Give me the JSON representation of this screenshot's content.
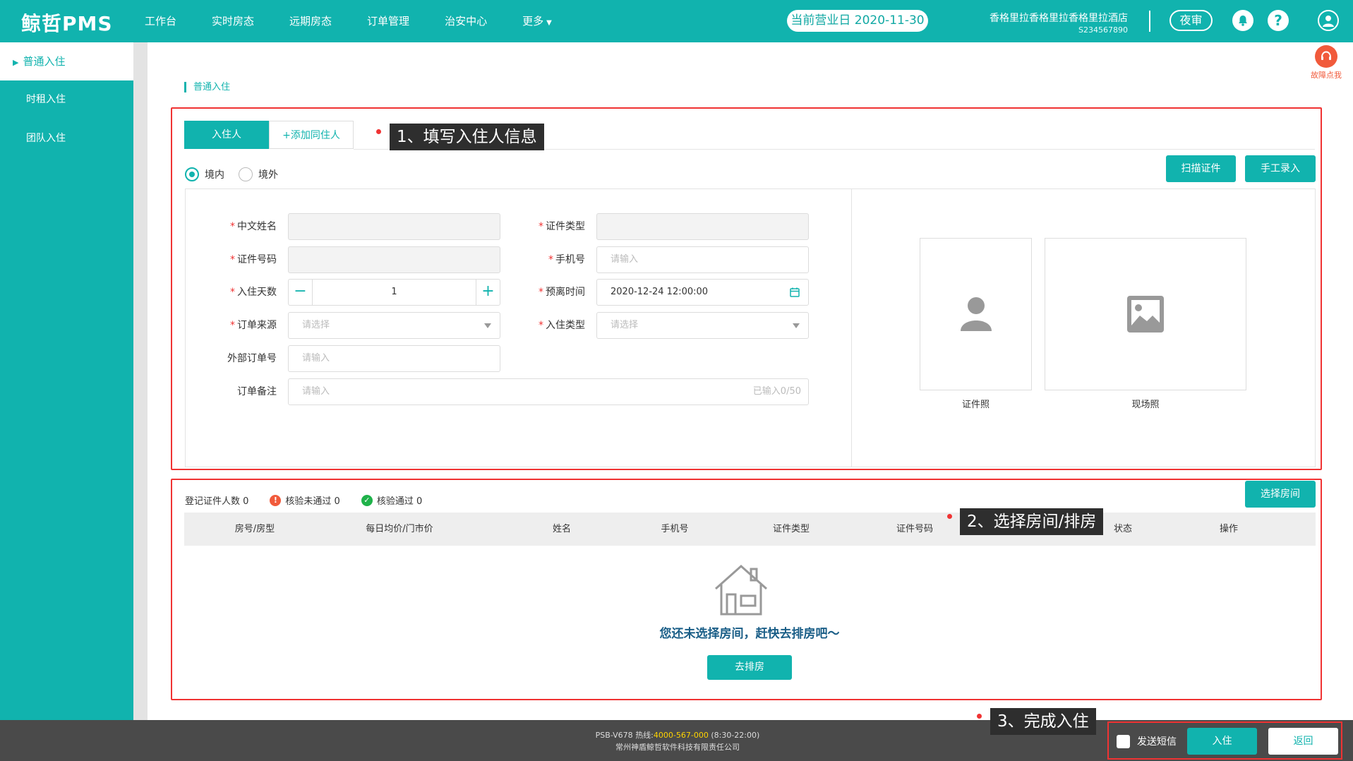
{
  "app": {
    "logo": "鲸哲PMS",
    "nav": [
      "工作台",
      "实时房态",
      "远期房态",
      "订单管理",
      "治安中心",
      "更多"
    ],
    "business_day": "当前营业日 2020-11-30",
    "hotel_name": "香格里拉香格里拉香格里拉酒店",
    "hotel_code": "S234567890",
    "night_audit": "夜审"
  },
  "sidebar": {
    "items": [
      "普通入住",
      "时租入住",
      "团队入住"
    ]
  },
  "fault": {
    "label": "故障点我"
  },
  "breadcrumb": "普通入住",
  "tabs": {
    "guest": "入住人",
    "add": "+添加同住人"
  },
  "callouts": [
    "1、填写入住人信息",
    "2、选择房间/排房",
    "3、完成入住"
  ],
  "origin": {
    "domestic": "境内",
    "foreign": "境外"
  },
  "buttons": {
    "scan": "扫描证件",
    "manual": "手工录入",
    "select_room": "选择房间",
    "assign": "去排房",
    "checkin": "入住",
    "back": "返回"
  },
  "form": {
    "name_label": "中文姓名",
    "id_type_label": "证件类型",
    "id_no_label": "证件号码",
    "phone_label": "手机号",
    "phone_placeholder": "请输入",
    "days_label": "入住天数",
    "days_value": "1",
    "depart_label": "预离时间",
    "depart_value": "2020-12-24 12:00:00",
    "source_label": "订单来源",
    "source_placeholder": "请选择",
    "checkin_type_label": "入住类型",
    "checkin_type_placeholder": "请选择",
    "ext_order_label": "外部订单号",
    "ext_order_placeholder": "请输入",
    "remark_label": "订单备注",
    "remark_placeholder": "请输入",
    "remark_counter": "已输入0/50"
  },
  "photos": {
    "id_photo": "证件照",
    "live_photo": "现场照"
  },
  "stats": {
    "registered": "登记证件人数 0",
    "failed": "核验未通过 0",
    "passed": "核验通过 0"
  },
  "table": {
    "columns": [
      "房号/房型",
      "每日均价/门市价",
      "姓名",
      "手机号",
      "证件类型",
      "证件号码",
      "状态",
      "操作"
    ]
  },
  "empty_text": "您还未选择房间，赶快去排房吧～",
  "footer": {
    "version": "PSB-V678",
    "hotline_label": "热线:",
    "hotline": "4000-567-000",
    "hours": "(8:30-22:00)",
    "company": "常州神盾鲸哲软件科技有限责任公司",
    "sms": "发送短信"
  },
  "colors": {
    "brand": "#11b3ae",
    "annotation": "#f03333",
    "error": "#f15a3b",
    "success": "#1fb24a"
  }
}
